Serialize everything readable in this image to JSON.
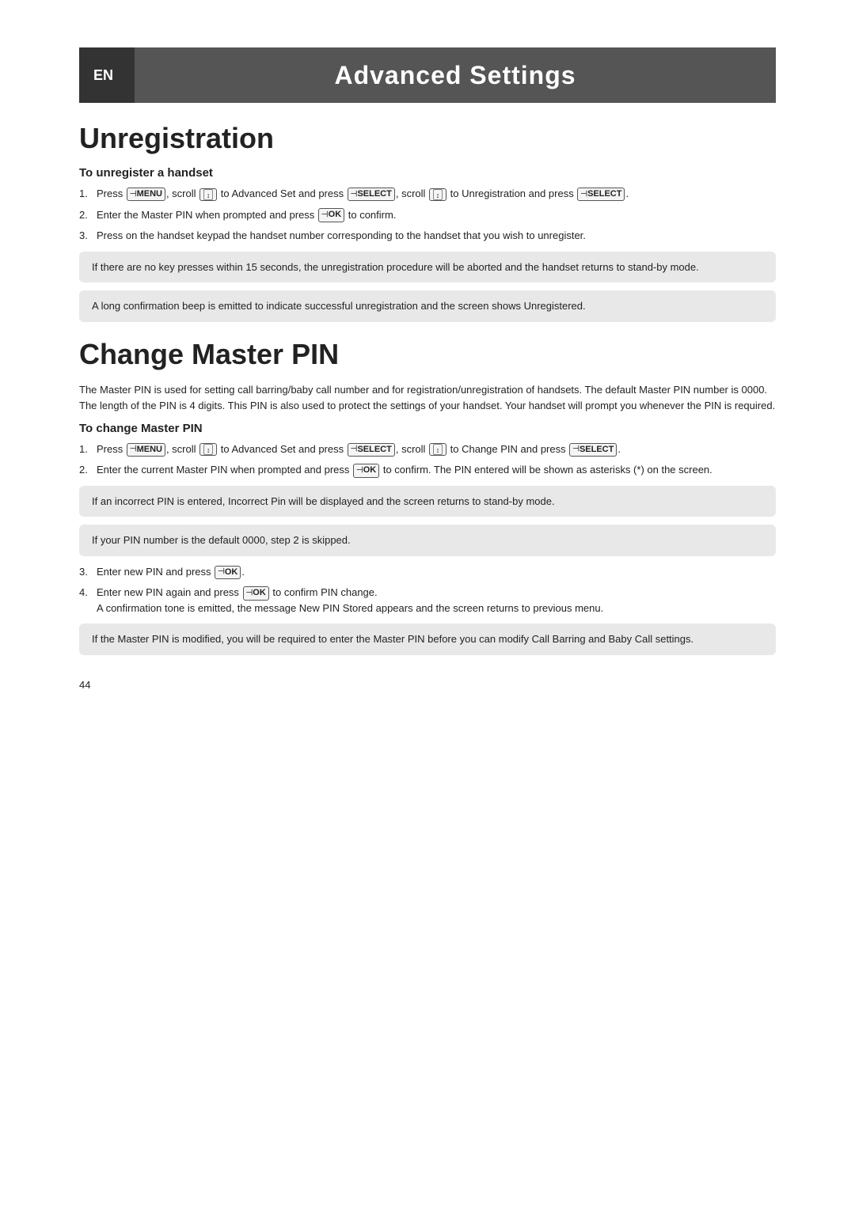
{
  "header": {
    "en_label": "EN",
    "title": "Advanced Settings"
  },
  "unregistration": {
    "section_title": "Unregistration",
    "subsection_title": "To unregister a handset",
    "steps": [
      {
        "num": "1.",
        "text": "Press MENU, scroll to Advanced Set and press SELECT, scroll to Unregistration and press SELECT."
      },
      {
        "num": "2.",
        "text": "Enter the Master PIN when prompted and press OK to confirm."
      },
      {
        "num": "3.",
        "text": "Press on the handset keypad the handset number corresponding to the handset that you wish to unregister."
      }
    ],
    "note1": "If there are no key presses within 15 seconds, the unregistration procedure will be aborted and the handset returns to stand-by mode.",
    "note2": "A long confirmation beep is emitted to indicate successful unregistration and the screen shows Unregistered."
  },
  "change_master_pin": {
    "section_title": "Change Master PIN",
    "intro": "The Master PIN is used for setting call barring/baby call number and for registration/unregistration of handsets. The default Master PIN number is 0000. The length of the PIN is 4 digits. This PIN is also used to protect the settings of your handset. Your handset will prompt you whenever the PIN is required.",
    "subsection_title": "To change Master PIN",
    "steps": [
      {
        "num": "1.",
        "text": "Press MENU, scroll to Advanced Set and press SELECT, scroll to Change PIN and press SELECT."
      },
      {
        "num": "2.",
        "text": "Enter the current Master PIN when prompted and press OK to confirm. The PIN entered will be shown as asterisks (*) on the screen."
      }
    ],
    "note1": "If an incorrect PIN is entered, Incorrect Pin will be displayed and the screen returns to stand-by mode.",
    "note2": "If your PIN number is the default 0000, step 2 is skipped.",
    "steps2": [
      {
        "num": "3.",
        "text": "Enter new PIN and press OK."
      },
      {
        "num": "4.",
        "text": "Enter new PIN again and press OK to confirm PIN change. A confirmation tone is emitted, the message New PIN Stored appears and the screen returns to previous menu."
      }
    ],
    "note3": "If the Master PIN is modified, you will be required to enter the Master PIN before you can modify Call Barring and Baby Call settings."
  },
  "page_number": "44",
  "icons": {
    "menu": "MENU",
    "select": "SELECT",
    "ok": "OK",
    "scroll": "↕"
  }
}
